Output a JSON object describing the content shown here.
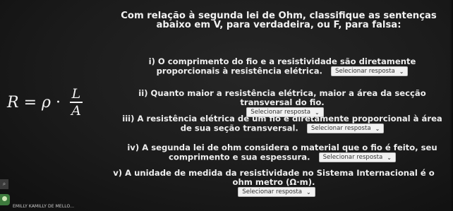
{
  "question": {
    "header": "Com relação à segunda lei de Ohm, classifique as sentenças abaixo em V, para verdadeira, ou F, para falsa:"
  },
  "formula": {
    "lhs": "R",
    "eq": "=",
    "rho": "ρ",
    "dot": "·",
    "numerator": "L",
    "denominator": "A"
  },
  "statements": [
    {
      "text": "i) O comprimento do fio e a resistividade são diretamente proporcionais à resistência elétrica.",
      "select_value": "Selecionar resposta"
    },
    {
      "text": "ii) Quanto maior a resistência elétrica, maior a área da secção transversal do fio.",
      "select_value": "Selecionar resposta"
    },
    {
      "text": "iii) A resistência elétrica de um fio é diretamente proporcional à área de sua seção transversal.",
      "select_value": "Selecionar resposta"
    },
    {
      "text": "iv) A segunda lei de ohm considera o material que o fio é feito, seu comprimento e sua espessura.",
      "select_value": "Selecionar resposta"
    },
    {
      "text": "v) A unidade de medida da resistividade no Sistema Internacional é o ohm metro (Ω·m).",
      "select_value": "Selecionar resposta"
    }
  ],
  "sidebar": {
    "search_icon": "search-icon",
    "username": "EMILLY KAMILLY DE MELLO..."
  }
}
